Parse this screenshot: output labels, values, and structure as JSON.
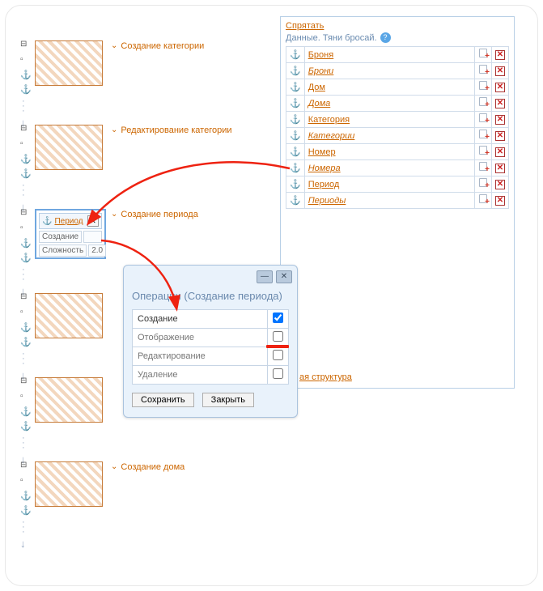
{
  "left_blocks": [
    {
      "label": "Создание категории"
    },
    {
      "label": "Редактирование категории"
    },
    {
      "label": "Создание периода",
      "selected": true,
      "tag": "Период",
      "rows": [
        {
          "k": "Создание",
          "v": ""
        },
        {
          "k": "Сложность",
          "v": "2.0"
        }
      ]
    },
    {
      "label": ""
    },
    {
      "label": ""
    },
    {
      "label": "Создание дома"
    }
  ],
  "right": {
    "hide": "Спрятать",
    "title": "Данные. Тяни бросай.",
    "items": [
      {
        "name": "Броня",
        "italic": false
      },
      {
        "name": "Брони",
        "italic": true
      },
      {
        "name": "Дом",
        "italic": false
      },
      {
        "name": "Дома",
        "italic": true
      },
      {
        "name": "Категория",
        "italic": false
      },
      {
        "name": "Категории",
        "italic": true
      },
      {
        "name": "Номер",
        "italic": false
      },
      {
        "name": "Номера",
        "italic": true
      },
      {
        "name": "Период",
        "italic": false
      },
      {
        "name": "Периоды",
        "italic": true
      }
    ],
    "bottom_link": "ая структура"
  },
  "dialog": {
    "title": "Операции (Создание периода)",
    "ops": [
      {
        "label": "Создание",
        "checked": true,
        "strong": true
      },
      {
        "label": "Отображение",
        "checked": false
      },
      {
        "label": "Редактирование",
        "checked": false
      },
      {
        "label": "Удаление",
        "checked": false
      }
    ],
    "save": "Сохранить",
    "close": "Закрыть"
  }
}
